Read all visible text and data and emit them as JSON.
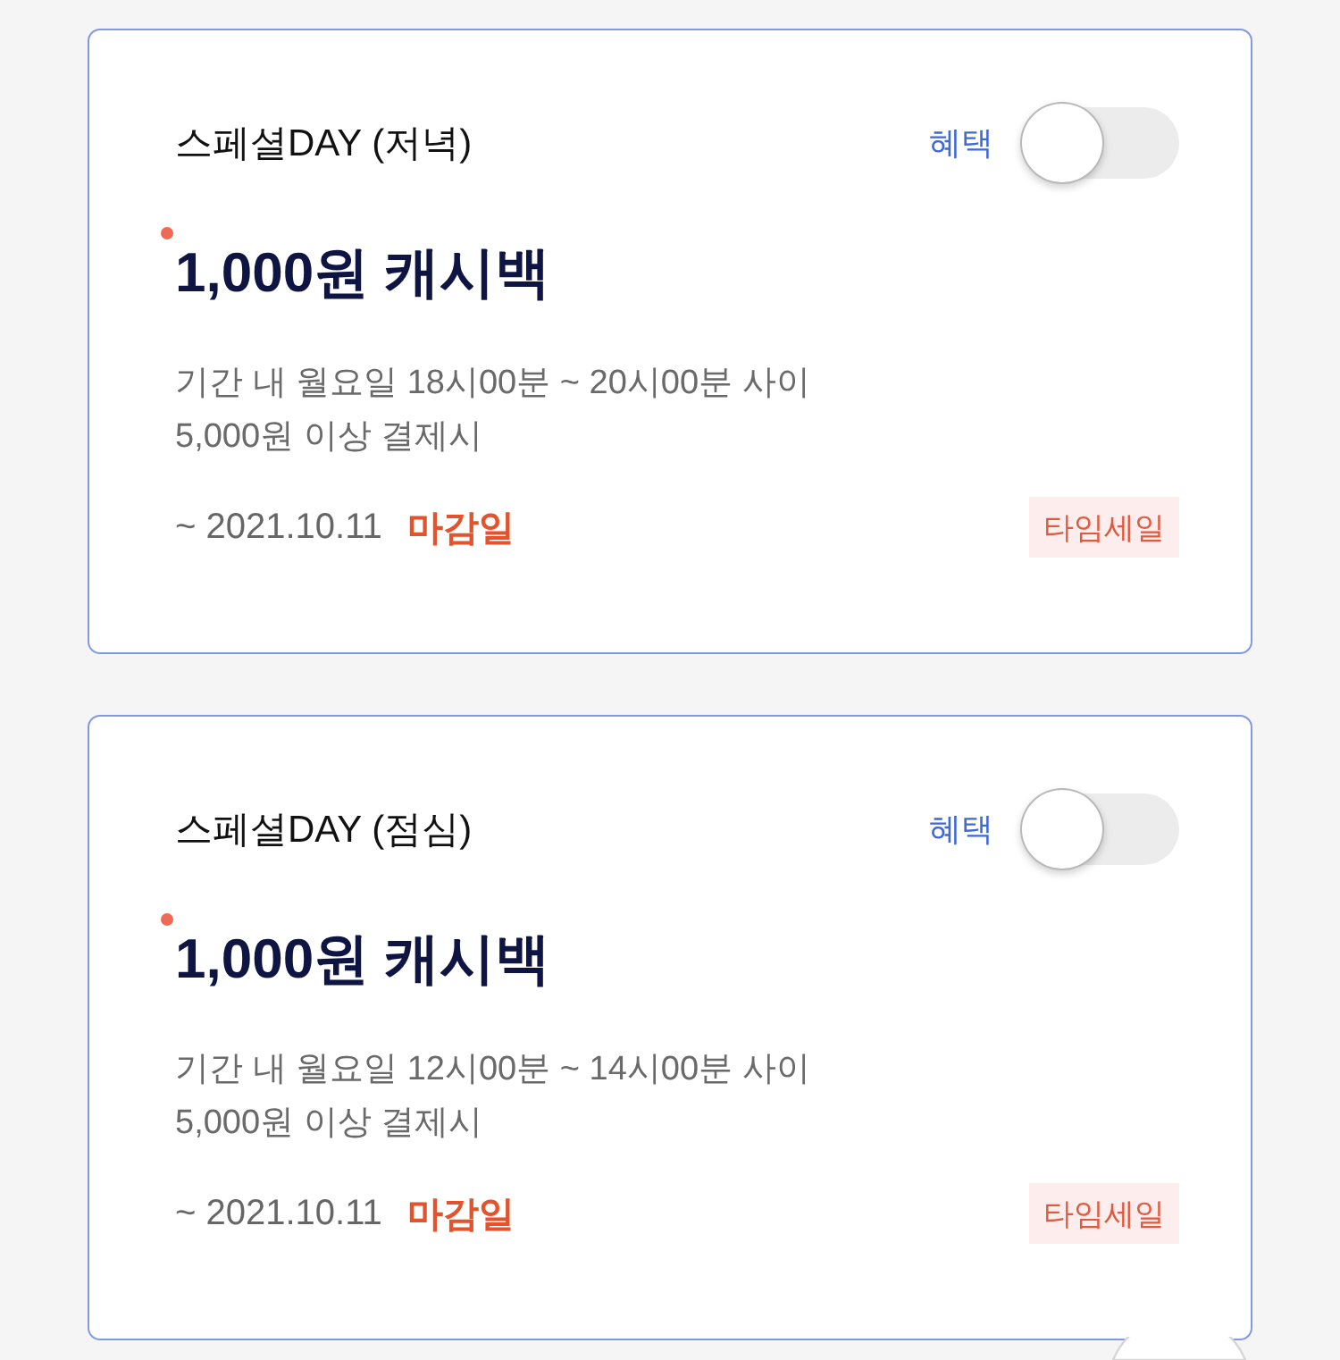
{
  "cards": [
    {
      "title": "스페셜DAY (저녁)",
      "benefit_label": "혜택",
      "benefit_on": false,
      "new_mark": true,
      "amount": "1,000원 캐시백",
      "conditions": [
        "기간 내 월요일 18시00분 ~ 20시00분 사이",
        "5,000원 이상 결제시"
      ],
      "due_date": "~ 2021.10.11",
      "due_label": "마감일",
      "tag": "타임세일"
    },
    {
      "title": "스페셜DAY (점심)",
      "benefit_label": "혜택",
      "benefit_on": false,
      "new_mark": true,
      "amount": "1,000원 캐시백",
      "conditions": [
        "기간 내 월요일 12시00분 ~ 14시00분 사이",
        "5,000원 이상 결제시"
      ],
      "due_date": "~ 2021.10.11",
      "due_label": "마감일",
      "tag": "타임세일"
    }
  ]
}
